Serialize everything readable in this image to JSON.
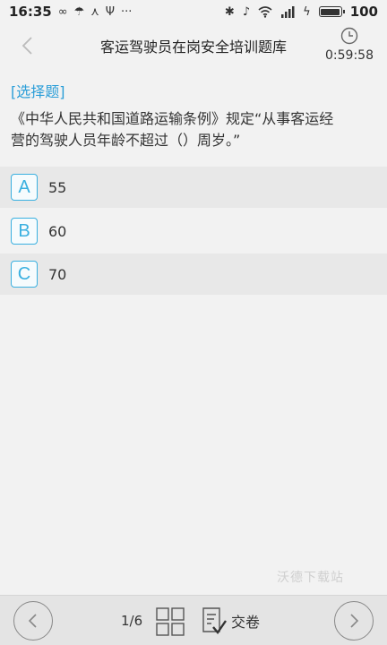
{
  "status_bar": {
    "time": "16:35",
    "battery": "100"
  },
  "header": {
    "title": "客运驾驶员在岗安全培训题库",
    "timer": "0:59:58"
  },
  "question": {
    "type": "[选择题]",
    "line1": "《中华人民共和国道路运输条例》规定“从事客运经",
    "line2": "营的驾驶人员年龄不超过（）周岁。”"
  },
  "options": [
    {
      "letter": "A",
      "text": "55"
    },
    {
      "letter": "B",
      "text": "60"
    },
    {
      "letter": "C",
      "text": "70"
    }
  ],
  "watermark": "沃德下载站",
  "bottom_bar": {
    "page_indicator": "1/6",
    "submit_label": "交卷"
  },
  "colors": {
    "accent": "#3ab0e0",
    "question_type": "#2b9ed8"
  }
}
